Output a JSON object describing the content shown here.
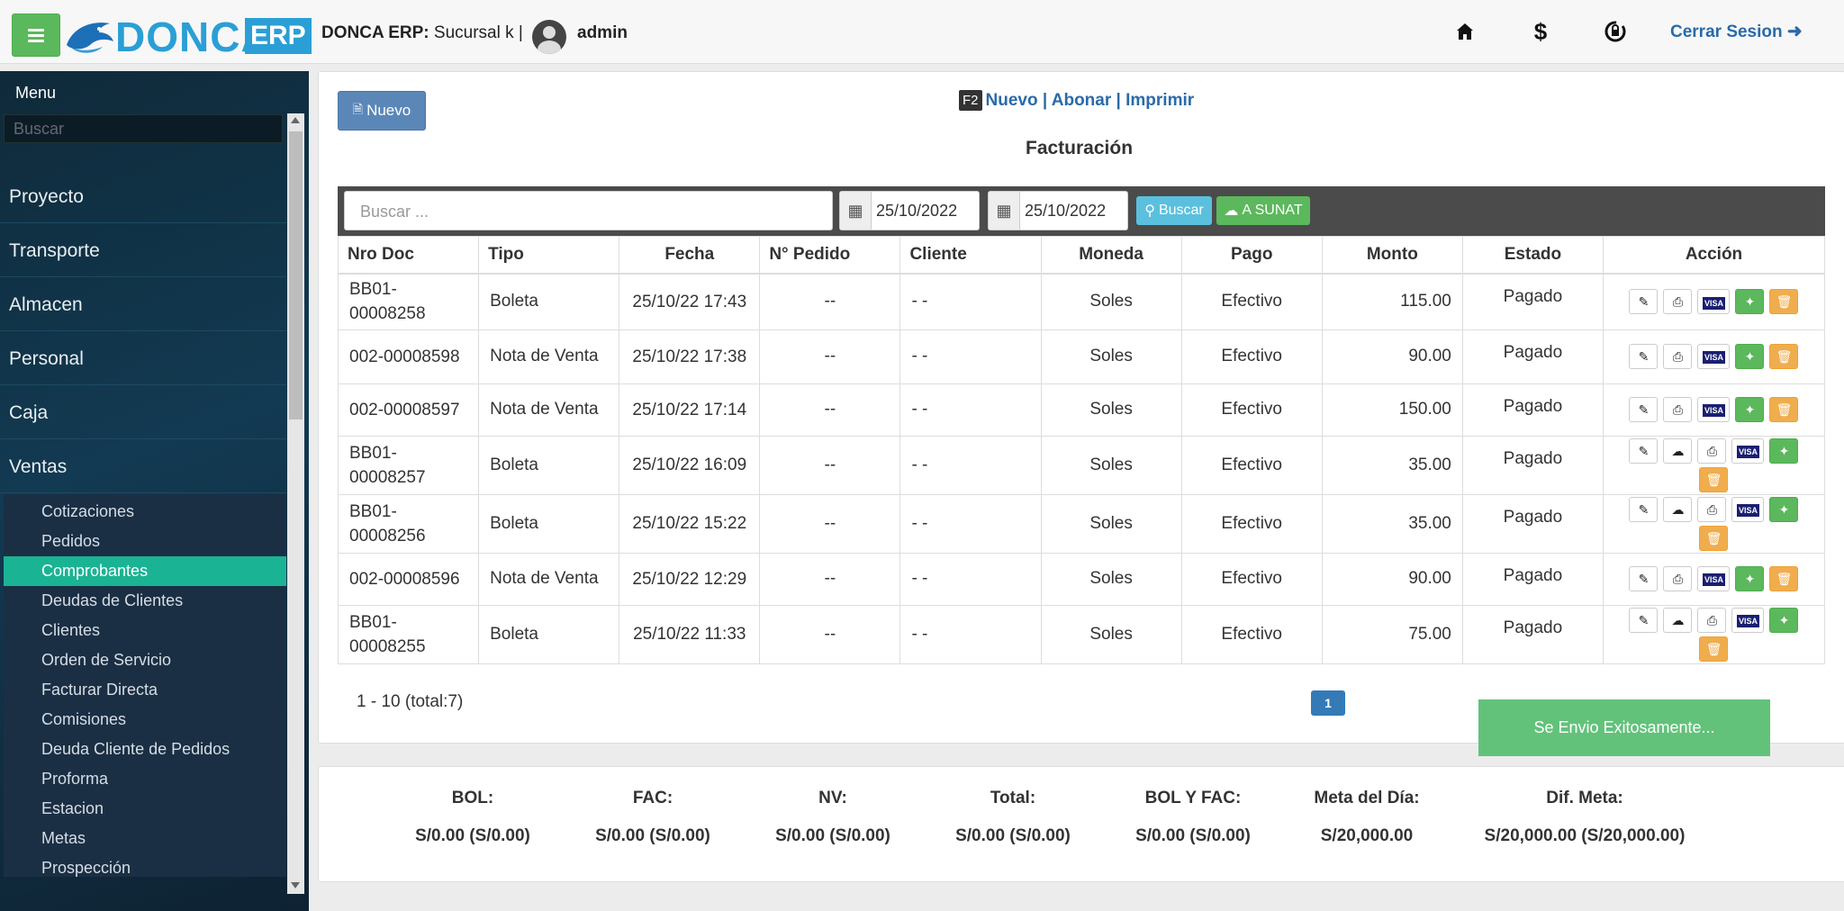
{
  "header": {
    "logo_text": "DONCA",
    "logo_erp": "ERP",
    "company_label": "DONCA ERP:",
    "branch": "Sucursal k |",
    "username": "admin",
    "logout_label": "Cerrar Sesion",
    "icons": [
      "home-icon",
      "dollar-icon",
      "sync-lock-icon",
      "sign-out-icon"
    ]
  },
  "sidebar": {
    "title": "Menu",
    "search_placeholder": "Buscar",
    "items": [
      "Proyecto",
      "Transporte",
      "Almacen",
      "Personal",
      "Caja",
      "Ventas"
    ],
    "submenu": [
      "Cotizaciones",
      "Pedidos",
      "Comprobantes",
      "Deudas de Clientes",
      "Clientes",
      "Orden de Servicio",
      "Facturar Directa",
      "Comisiones",
      "Deuda Cliente de Pedidos",
      "Proforma",
      "Estacion",
      "Metas",
      "Prospección"
    ],
    "active_submenu": "Comprobantes"
  },
  "main": {
    "new_button": "Nuevo",
    "shortcut_key": "F2",
    "shortcut_text": "Nuevo | Abonar | Imprimir",
    "title": "Facturación",
    "search_placeholder": "Buscar ...",
    "date_from": "25/10/2022",
    "date_to": "25/10/2022",
    "search_button": "Buscar",
    "sunat_button": "A SUNAT"
  },
  "table": {
    "columns": [
      "Nro Doc",
      "Tipo",
      "Fecha",
      "N° Pedido",
      "Cliente",
      "Moneda",
      "Pago",
      "Monto",
      "Estado",
      "Acción"
    ],
    "rows": [
      {
        "doc": "BB01-00008258",
        "tipo": "Boleta",
        "fecha": "25/10/22 17:43",
        "pedido": "--",
        "cliente": "- -",
        "moneda": "Soles",
        "pago": "Efectivo",
        "monto": "115.00",
        "estado": "Pagado",
        "cloud": false
      },
      {
        "doc": "002-00008598",
        "tipo": "Nota de Venta",
        "fecha": "25/10/22 17:38",
        "pedido": "--",
        "cliente": "- -",
        "moneda": "Soles",
        "pago": "Efectivo",
        "monto": "90.00",
        "estado": "Pagado",
        "cloud": false
      },
      {
        "doc": "002-00008597",
        "tipo": "Nota de Venta",
        "fecha": "25/10/22 17:14",
        "pedido": "--",
        "cliente": "- -",
        "moneda": "Soles",
        "pago": "Efectivo",
        "monto": "150.00",
        "estado": "Pagado",
        "cloud": false
      },
      {
        "doc": "BB01-00008257",
        "tipo": "Boleta",
        "fecha": "25/10/22 16:09",
        "pedido": "--",
        "cliente": "- -",
        "moneda": "Soles",
        "pago": "Efectivo",
        "monto": "35.00",
        "estado": "Pagado",
        "cloud": true
      },
      {
        "doc": "BB01-00008256",
        "tipo": "Boleta",
        "fecha": "25/10/22 15:22",
        "pedido": "--",
        "cliente": "- -",
        "moneda": "Soles",
        "pago": "Efectivo",
        "monto": "35.00",
        "estado": "Pagado",
        "cloud": true
      },
      {
        "doc": "002-00008596",
        "tipo": "Nota de Venta",
        "fecha": "25/10/22 12:29",
        "pedido": "--",
        "cliente": "- -",
        "moneda": "Soles",
        "pago": "Efectivo",
        "monto": "90.00",
        "estado": "Pagado",
        "cloud": false
      },
      {
        "doc": "BB01-00008255",
        "tipo": "Boleta",
        "fecha": "25/10/22 11:33",
        "pedido": "--",
        "cliente": "- -",
        "moneda": "Soles",
        "pago": "Efectivo",
        "monto": "75.00",
        "estado": "Pagado",
        "cloud": true
      }
    ]
  },
  "pagination": {
    "summary": "1 - 10 (total:7)",
    "current_page": "1"
  },
  "toast": {
    "message": "Se Envio Exitosamente..."
  },
  "summary": [
    {
      "label": "BOL:",
      "value": "S/0.00 (S/0.00)"
    },
    {
      "label": "FAC:",
      "value": "S/0.00 (S/0.00)"
    },
    {
      "label": "NV:",
      "value": "S/0.00 (S/0.00)"
    },
    {
      "label": "Total:",
      "value": "S/0.00 (S/0.00)"
    },
    {
      "label": "BOL Y FAC:",
      "value": "S/0.00 (S/0.00)"
    },
    {
      "label": "Meta del Día:",
      "value": "S/20,000.00"
    },
    {
      "label": "Dif. Meta:",
      "value": "S/20,000.00 (S/20,000.00)"
    }
  ],
  "colors": {
    "accent_green": "#5cb85c",
    "accent_blue": "#337ab7",
    "sidebar_active": "#1ab394",
    "warning_orange": "#f0ad4e",
    "info_blue": "#5bc0de"
  }
}
